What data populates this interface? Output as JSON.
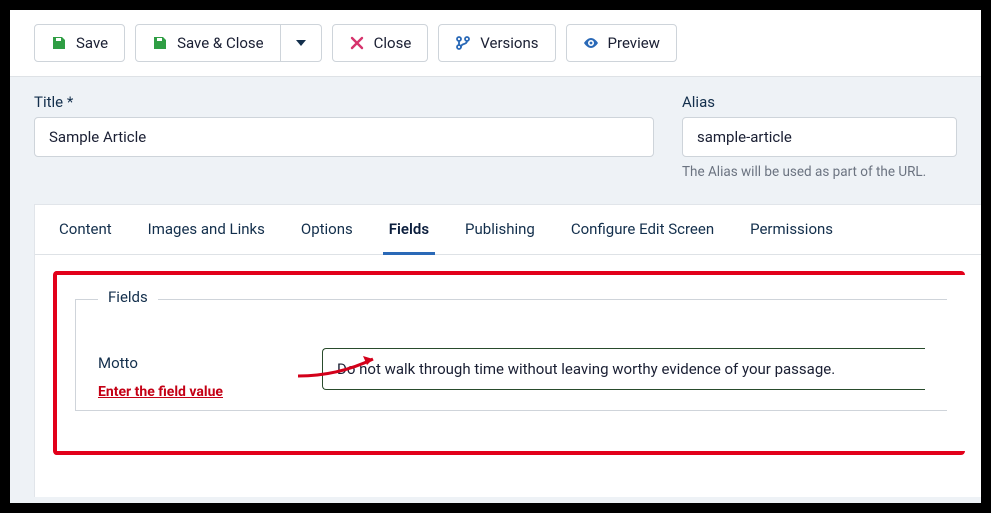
{
  "toolbar": {
    "save": "Save",
    "saveClose": "Save & Close",
    "close": "Close",
    "versions": "Versions",
    "preview": "Preview"
  },
  "titleField": {
    "label": "Title *",
    "value": "Sample Article"
  },
  "aliasField": {
    "label": "Alias",
    "value": "sample-article",
    "hint": "The Alias will be used as part of the URL."
  },
  "tabs": {
    "content": "Content",
    "imagesLinks": "Images and Links",
    "options": "Options",
    "fields": "Fields",
    "publishing": "Publishing",
    "editScreen": "Configure Edit Screen",
    "permissions": "Permissions"
  },
  "fieldsPanel": {
    "legend": "Fields",
    "mottoLabel": "Motto",
    "mottoValue": "Do not walk through time without leaving worthy evidence of your passage.",
    "annotation": "Enter the field value"
  }
}
